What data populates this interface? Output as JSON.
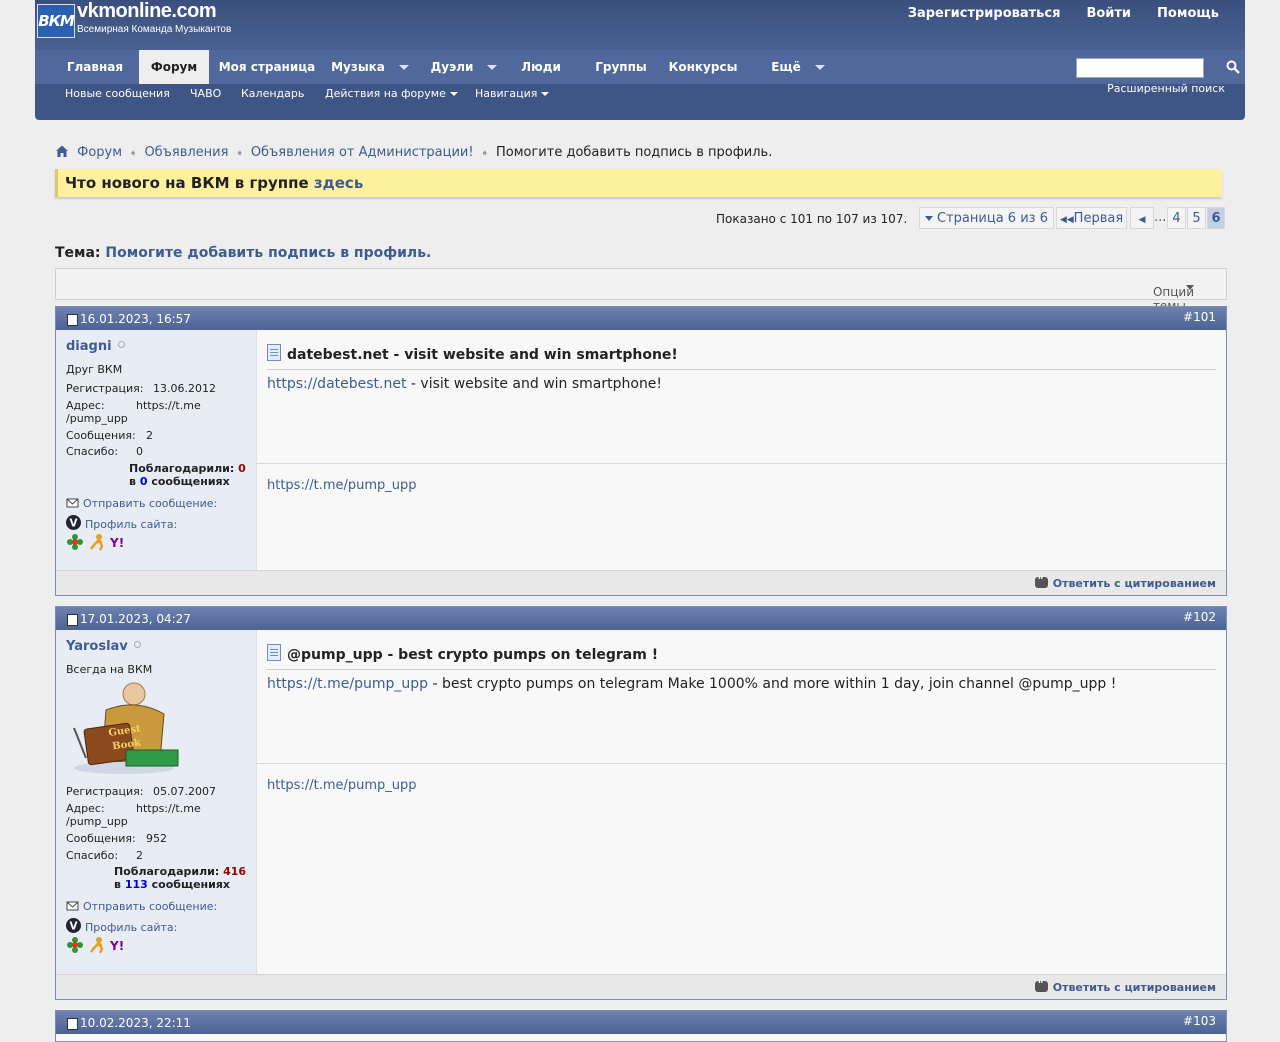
{
  "site": {
    "logo_box": "ВКМ",
    "logo_name": "vkmonline.com",
    "logo_tagline": "Всемирная Команда Музыкантов"
  },
  "toplinks": [
    "Зарегистрироваться",
    "Войти",
    "Помощь"
  ],
  "nav": {
    "tabs": [
      "Главная",
      "Форум",
      "Моя страница",
      "Музыка",
      "Дуэли",
      "Люди",
      "Группы",
      "Конкурсы",
      "Ещё"
    ],
    "active": "Форум",
    "search_value": "",
    "advanced_search": "Расширенный поиск"
  },
  "subnav": [
    "Новые сообщения",
    "ЧАВО",
    "Календарь",
    "Действия на форуме",
    "Навигация"
  ],
  "breadcrumb": [
    "Форум",
    "Объявления",
    "Объявления от Администрации!",
    "Помогите добавить подпись в профиль."
  ],
  "notice": {
    "text": "Что нового на ВКМ в группе ",
    "link": "здесь"
  },
  "pagination": {
    "stats": "Показано с 101 по 107 из 107.",
    "page_label": "Страница 6 из 6",
    "first": "Первая",
    "ellipsis": "...",
    "pages": [
      "4",
      "5",
      "6"
    ],
    "current": "6"
  },
  "thread": {
    "label": "Тема:",
    "title": "Помогите добавить подпись в профиль.",
    "options": "Опции темы"
  },
  "posts": [
    {
      "date": "16.01.2023, 16:57",
      "number": "#101",
      "username": "diagni",
      "user_title": "Друг ВКМ",
      "reg_label": "Регистрация:",
      "reg_value": "13.06.2012",
      "addr_label": "Адрес:",
      "addr_value1": "https://t.me",
      "addr_value2": "/pump_upp",
      "msgs_label": "Сообщения:",
      "msgs_value": "2",
      "thanks_label": "Спасибо:",
      "thanks_value": "0",
      "thanked_label": "Поблагодарили:",
      "thanked_value": "0",
      "in_label": "в",
      "in_value": "0",
      "in_suffix": "сообщениях",
      "send_msg": "Отправить сообщение:",
      "profile": "Профиль сайта:",
      "title": "datebest.net - visit website and win smartphone!",
      "body_link": "https://datebest.net",
      "body_text": " - visit website and win smartphone!",
      "signature": "https://t.me/pump_upp",
      "reply": "Ответить с цитированием"
    },
    {
      "date": "17.01.2023, 04:27",
      "number": "#102",
      "username": "Yaroslav",
      "user_title": "Всегда на ВКМ",
      "avatar_text1": "Guest",
      "avatar_text2": "Book",
      "reg_label": "Регистрация:",
      "reg_value": "05.07.2007",
      "addr_label": "Адрес:",
      "addr_value1": "https://t.me",
      "addr_value2": "/pump_upp",
      "msgs_label": "Сообщения:",
      "msgs_value": "952",
      "thanks_label": "Спасибо:",
      "thanks_value": "2",
      "thanked_label": "Поблагодарили:",
      "thanked_value": "416",
      "in_label": "в",
      "in_value": "113",
      "in_suffix": "сообщениях",
      "send_msg": "Отправить сообщение:",
      "profile": "Профиль сайта:",
      "title": "@pump_upp - best crypto pumps on telegram !",
      "body_link": "https://t.me/pump_upp",
      "body_text": " - best crypto pumps on telegram Make 1000% and more within 1 day, join channel @pump_upp !",
      "signature": "https://t.me/pump_upp",
      "reply": "Ответить с цитированием"
    },
    {
      "date": "10.02.2023, 22:11",
      "number": "#103"
    }
  ]
}
